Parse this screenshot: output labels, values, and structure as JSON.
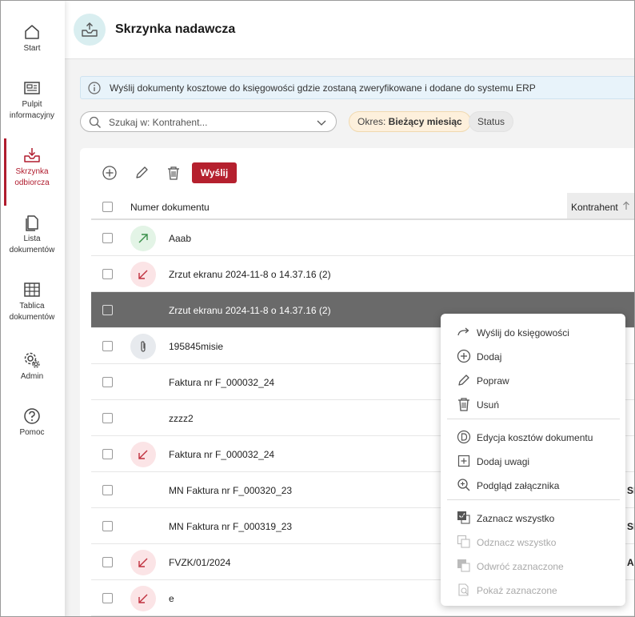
{
  "sidebar": {
    "items": [
      {
        "label": "Start",
        "icon": "home-icon"
      },
      {
        "label": "Pulpit informacyjny",
        "icon": "dashboard-icon"
      },
      {
        "label": "Skrzynka odbiorcza",
        "icon": "inbox-icon",
        "active": true
      },
      {
        "label": "Lista dokumentów",
        "icon": "documents-icon"
      },
      {
        "label": "Tablica dokumentów",
        "icon": "table-icon"
      },
      {
        "label": "Admin",
        "icon": "admin-gear-icon"
      },
      {
        "label": "Pomoc",
        "icon": "help-icon"
      }
    ]
  },
  "header": {
    "title": "Skrzynka nadawcza",
    "icon": "outbox-icon"
  },
  "info": {
    "text": "Wyślij dokumenty kosztowe do księgowości gdzie zostaną zweryfikowane i dodane do systemu ERP"
  },
  "search": {
    "placeholder": "Szukaj w: Kontrahent..."
  },
  "filters": {
    "period_label": "Okres: ",
    "period_value": "Bieżący miesiąc",
    "status_label": "Status"
  },
  "toolbar": {
    "send_label": "Wyślij"
  },
  "table": {
    "headers": {
      "number": "Numer dokumentu",
      "contractor": "Kontrahent"
    },
    "rows": [
      {
        "name": "Aaab",
        "avatar": "outgoing-arrow",
        "extra": ""
      },
      {
        "name": "Zrzut ekranu 2024-11-8 o 14.37.16 (2)",
        "avatar": "incoming-arrow",
        "extra": ""
      },
      {
        "name": "Zrzut ekranu 2024-11-8 o 14.37.16 (2)",
        "avatar": "",
        "extra": "",
        "selected": true
      },
      {
        "name": "195845misie",
        "avatar": "attachment",
        "extra": ""
      },
      {
        "name": "Faktura nr F_000032_24",
        "avatar": "",
        "extra": ""
      },
      {
        "name": "zzzz2",
        "avatar": "",
        "extra": ""
      },
      {
        "name": "Faktura nr F_000032_24",
        "avatar": "incoming-arrow",
        "extra": ""
      },
      {
        "name": "MN Faktura nr F_000320_23",
        "avatar": "",
        "extra": "SI"
      },
      {
        "name": "MN Faktura nr F_000319_23",
        "avatar": "",
        "extra": "SI"
      },
      {
        "name": "FVZK/01/2024",
        "avatar": "incoming-arrow",
        "extra": "A"
      },
      {
        "name": "e",
        "avatar": "incoming-arrow",
        "extra": ""
      }
    ]
  },
  "context_menu": {
    "items": [
      {
        "label": "Wyślij do księgowości",
        "icon": "send-arrow-icon"
      },
      {
        "label": "Dodaj",
        "icon": "add-circle-icon"
      },
      {
        "label": "Popraw",
        "icon": "pencil-icon"
      },
      {
        "label": "Usuń",
        "icon": "trash-icon"
      },
      {
        "label": "Edycja kosztów dokumentu",
        "icon": "cost-circle-icon"
      },
      {
        "label": "Dodaj uwagi",
        "icon": "add-note-icon"
      },
      {
        "label": "Podgląd załącznika",
        "icon": "zoom-icon"
      },
      {
        "label": "Zaznacz wszystko",
        "icon": "select-all-icon"
      },
      {
        "label": "Odznacz wszystko",
        "icon": "deselect-all-icon",
        "disabled": true
      },
      {
        "label": "Odwróć zaznaczone",
        "icon": "invert-selection-icon",
        "disabled": true
      },
      {
        "label": "Pokaż zaznaczone",
        "icon": "show-selected-icon",
        "disabled": true
      }
    ]
  },
  "colors": {
    "accent": "#b5202e",
    "selected_row": "#6a6a6a",
    "header_icon_bg": "#d9eef0"
  }
}
